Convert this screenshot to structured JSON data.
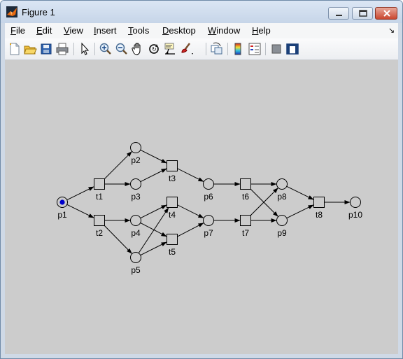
{
  "window": {
    "title": "Figure 1"
  },
  "menu": [
    {
      "label": "File",
      "key": "F",
      "rest": "ile"
    },
    {
      "label": "Edit",
      "key": "E",
      "rest": "dit"
    },
    {
      "label": "View",
      "key": "V",
      "rest": "iew"
    },
    {
      "label": "Insert",
      "key": "I",
      "rest": "nsert"
    },
    {
      "label": "Tools",
      "key": "T",
      "rest": "ools"
    },
    {
      "label": "Desktop",
      "key": "D",
      "rest": "esktop"
    },
    {
      "label": "Window",
      "key": "W",
      "rest": "indow"
    },
    {
      "label": "Help",
      "key": "H",
      "rest": "elp"
    }
  ],
  "toolbar": {
    "buttons": [
      "new-figure",
      "open-file",
      "save-figure",
      "print-figure",
      "edit-plot",
      "zoom-in",
      "zoom-out",
      "pan",
      "rotate-3d",
      "data-cursor",
      "brush",
      "link-plot",
      "insert-colorbar",
      "insert-legend",
      "hide-plot-tools",
      "show-plot-tools"
    ]
  },
  "diagram": {
    "places": [
      {
        "id": "p1",
        "label": "p1",
        "marked": true
      },
      {
        "id": "p2",
        "label": "p2",
        "marked": false
      },
      {
        "id": "p3",
        "label": "p3",
        "marked": false
      },
      {
        "id": "p4",
        "label": "p4",
        "marked": false
      },
      {
        "id": "p5",
        "label": "p5",
        "marked": false
      },
      {
        "id": "p6",
        "label": "p6",
        "marked": false
      },
      {
        "id": "p7",
        "label": "p7",
        "marked": false
      },
      {
        "id": "p8",
        "label": "p8",
        "marked": false
      },
      {
        "id": "p9",
        "label": "p9",
        "marked": false
      },
      {
        "id": "p10",
        "label": "p10",
        "marked": false
      }
    ],
    "transitions": [
      {
        "id": "t1",
        "label": "t1"
      },
      {
        "id": "t2",
        "label": "t2"
      },
      {
        "id": "t3",
        "label": "t3"
      },
      {
        "id": "t4",
        "label": "t4"
      },
      {
        "id": "t5",
        "label": "t5"
      },
      {
        "id": "t6",
        "label": "t6"
      },
      {
        "id": "t7",
        "label": "t7"
      },
      {
        "id": "t8",
        "label": "t8"
      }
    ],
    "arcs": [
      [
        "p1",
        "t1"
      ],
      [
        "p1",
        "t2"
      ],
      [
        "t1",
        "p2"
      ],
      [
        "t1",
        "p3"
      ],
      [
        "t2",
        "p4"
      ],
      [
        "t2",
        "p5"
      ],
      [
        "p2",
        "t3"
      ],
      [
        "p3",
        "t3"
      ],
      [
        "p4",
        "t4"
      ],
      [
        "p4",
        "t5"
      ],
      [
        "p5",
        "t4"
      ],
      [
        "p5",
        "t5"
      ],
      [
        "t3",
        "p6"
      ],
      [
        "t4",
        "p7"
      ],
      [
        "t5",
        "p7"
      ],
      [
        "p6",
        "t6"
      ],
      [
        "p7",
        "t7"
      ],
      [
        "t6",
        "p8"
      ],
      [
        "t6",
        "p9"
      ],
      [
        "t7",
        "p8"
      ],
      [
        "t7",
        "p9"
      ],
      [
        "p8",
        "t8"
      ],
      [
        "p9",
        "t8"
      ],
      [
        "t8",
        "p10"
      ]
    ],
    "colors": {
      "background": "#cccccc",
      "token": "#0000cc",
      "stroke": "#000000"
    }
  }
}
